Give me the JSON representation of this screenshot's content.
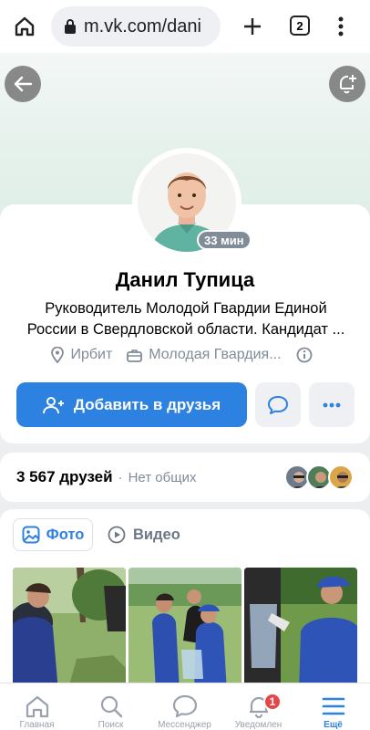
{
  "browser": {
    "url": "m.vk.com/dani",
    "tab_count": "2"
  },
  "profile": {
    "name": "Данил Тупица",
    "status": "Руководитель Молодой Гвардии Единой России в Свердловской области. Кандидат ...",
    "online_time": "33 мин",
    "city": "Ирбит",
    "work": "Молодая Гвардия..."
  },
  "actions": {
    "add_friend": "Добавить в друзья"
  },
  "friends": {
    "count": "3 567 друзей",
    "separator": "·",
    "common": "Нет общих"
  },
  "media_tabs": {
    "photo": "Фото",
    "video": "Видео"
  },
  "bottom_nav": {
    "items": [
      {
        "label": "Главная",
        "icon": "home-icon"
      },
      {
        "label": "Поиск",
        "icon": "search-icon"
      },
      {
        "label": "Мессенджер",
        "icon": "messenger-icon"
      },
      {
        "label": "Уведомлен",
        "icon": "bell-icon",
        "badge": "1"
      },
      {
        "label": "Ещё",
        "icon": "menu-icon",
        "active": true
      }
    ]
  },
  "colors": {
    "accent": "#2d81e0",
    "secondary_button": "#eef0f3",
    "muted_text": "#818c99",
    "badge": "#e64646"
  }
}
